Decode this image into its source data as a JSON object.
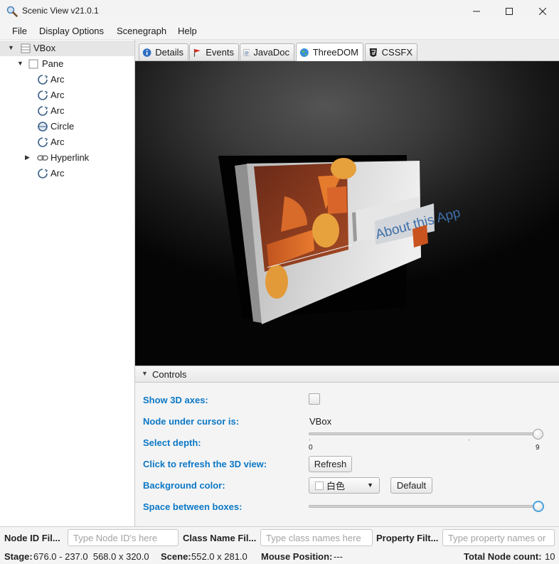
{
  "window": {
    "title": "Scenic View v21.0.1"
  },
  "menu": {
    "items": [
      "File",
      "Display Options",
      "Scenegraph",
      "Help"
    ]
  },
  "tree": {
    "nodes": [
      {
        "label": "VBox",
        "icon": "vbox-icon",
        "expanded": true,
        "selected": true
      },
      {
        "label": "Pane",
        "icon": "pane-icon",
        "expanded": true
      },
      {
        "label": "Arc",
        "icon": "arc-icon"
      },
      {
        "label": "Arc",
        "icon": "arc-icon"
      },
      {
        "label": "Arc",
        "icon": "arc-icon"
      },
      {
        "label": "Circle",
        "icon": "circle-icon"
      },
      {
        "label": "Arc",
        "icon": "arc-icon"
      },
      {
        "label": "Hyperlink",
        "icon": "hyperlink-icon",
        "expanded": false
      },
      {
        "label": "Arc",
        "icon": "arc-icon"
      }
    ]
  },
  "tabs": [
    {
      "label": "Details",
      "icon": "info-icon"
    },
    {
      "label": "Events",
      "icon": "flag-icon"
    },
    {
      "label": "JavaDoc",
      "icon": "at-icon"
    },
    {
      "label": "ThreeDOM",
      "icon": "globe-icon",
      "active": true
    },
    {
      "label": "CSSFX",
      "icon": "css-icon"
    }
  ],
  "viewport": {
    "sign_text": "About this App"
  },
  "controls": {
    "title": "Controls",
    "show_axes_label": "Show 3D axes:",
    "show_axes_checked": false,
    "node_under_cursor_label": "Node under cursor is:",
    "node_under_cursor_value": "VBox",
    "select_depth_label": "Select depth:",
    "depth_min": "0",
    "depth_max": "9",
    "depth_value": 9,
    "refresh_label": "Click to refresh the 3D view:",
    "refresh_button": "Refresh",
    "bg_color_label": "Background color:",
    "bg_color_value": "白色",
    "default_button": "Default",
    "space_label": "Space between boxes:",
    "space_fraction": 1.0
  },
  "filters": {
    "node_id_label": "Node ID Fil...",
    "node_id_placeholder": "Type Node ID's here",
    "class_name_label": "Class Name Fil...",
    "class_name_placeholder": "Type class names here",
    "property_label": "Property Filt...",
    "property_placeholder": "Type property names or"
  },
  "status": {
    "stage_label": "Stage:",
    "stage_value": "676.0 - 237.0  568.0 x 320.0",
    "scene_label": "Scene:",
    "scene_value": "552.0 x 281.0",
    "mouse_label": "Mouse Position:",
    "mouse_value": "---",
    "total_label": "Total Node count:",
    "total_value": "10"
  },
  "colors": {
    "accent_label": "#0b78c6",
    "selected_row": "#e6e6e6",
    "focus_ring": "#4aa3df"
  }
}
